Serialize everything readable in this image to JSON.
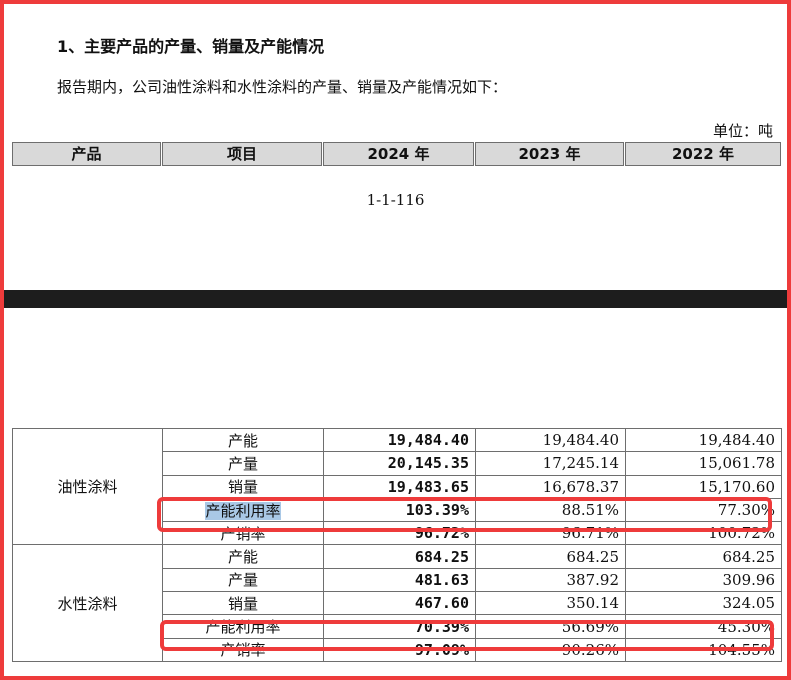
{
  "section_title": "1、主要产品的产量、销量及产能情况",
  "intro": "报告期内，公司油性涂料和水性涂料的产量、销量及产能情况如下：",
  "unit": "单位：吨",
  "columns": [
    "产品",
    "项目",
    "2024 年",
    "2023 年",
    "2022 年"
  ],
  "page_number": "1-1-116",
  "products": [
    {
      "name": "油性涂料",
      "rows": [
        {
          "item": "产能",
          "y2024": "19,484.40",
          "y2023": "19,484.40",
          "y2022": "19,484.40"
        },
        {
          "item": "产量",
          "y2024": "20,145.35",
          "y2023": "17,245.14",
          "y2022": "15,061.78"
        },
        {
          "item": "销量",
          "y2024": "19,483.65",
          "y2023": "16,678.37",
          "y2022": "15,170.60"
        },
        {
          "item": "产能利用率",
          "y2024": "103.39%",
          "y2023": "88.51%",
          "y2022": "77.30%"
        },
        {
          "item": "产销率",
          "y2024": "96.72%",
          "y2023": "96.71%",
          "y2022": "100.72%"
        }
      ]
    },
    {
      "name": "水性涂料",
      "rows": [
        {
          "item": "产能",
          "y2024": "684.25",
          "y2023": "684.25",
          "y2022": "684.25"
        },
        {
          "item": "产量",
          "y2024": "481.63",
          "y2023": "387.92",
          "y2022": "309.96"
        },
        {
          "item": "销量",
          "y2024": "467.60",
          "y2023": "350.14",
          "y2022": "324.05"
        },
        {
          "item": "产能利用率",
          "y2024": "70.39%",
          "y2023": "56.69%",
          "y2022": "45.30%"
        },
        {
          "item": "产销率",
          "y2024": "97.09%",
          "y2023": "90.26%",
          "y2022": "104.55%"
        }
      ]
    }
  ],
  "highlight_color": "#a9c8e6",
  "annotation_color": "#ee3b3b"
}
